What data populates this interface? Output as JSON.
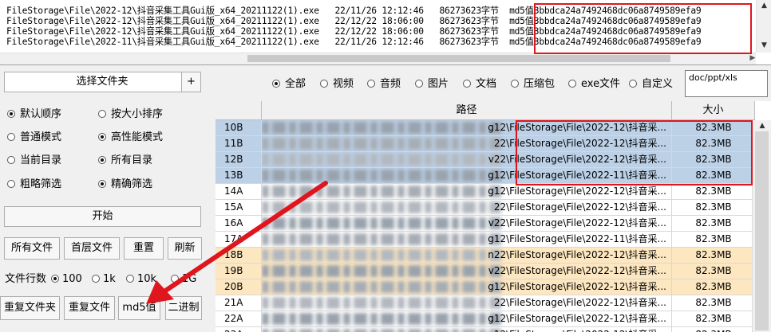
{
  "log": {
    "lines": [
      "FileStorage\\File\\2022-12\\抖音采集工具Gui版_x64_20211122(1).exe   22/11/26 12:12:46   86273623字节  md5值3bbdca24a7492468dc06a8749589efa9",
      "FileStorage\\File\\2022-12\\抖音采集工具Gui版_x64_20211122(1).exe   22/12/22 18:06:00   86273623字节  md5值3bbdca24a7492468dc06a8749589efa9",
      "FileStorage\\File\\2022-12\\抖音采集工具Gui版_x64_20211122(1).exe   22/12/22 18:06:00   86273623字节  md5值3bbdca24a7492468dc06a8749589efa9",
      "FileStorage\\File\\2022-11\\抖音采集工具Gui版_x64_20211122(1).exe   22/11/26 12:12:46   86273623字节  md5值3bbdca24a7492468dc06a8749589efa9"
    ]
  },
  "left": {
    "choose_folder": "选择文件夹",
    "plus": "+",
    "radios": [
      {
        "label": "默认顺序",
        "checked": true
      },
      {
        "label": "按大小排序",
        "checked": false
      },
      {
        "label": "普通模式",
        "checked": false
      },
      {
        "label": "高性能模式",
        "checked": true
      },
      {
        "label": "当前目录",
        "checked": false
      },
      {
        "label": "所有目录",
        "checked": true
      },
      {
        "label": "粗略筛选",
        "checked": false
      },
      {
        "label": "精确筛选",
        "checked": true
      }
    ],
    "start": "开始",
    "btns1": [
      "所有文件",
      "首层文件",
      "重置",
      "刷新"
    ],
    "rows_label": "文件行数",
    "rows_opts": [
      {
        "label": "100",
        "checked": true
      },
      {
        "label": "1k",
        "checked": false
      },
      {
        "label": "10k",
        "checked": false
      },
      {
        "label": "1G",
        "checked": false
      }
    ],
    "btns2": [
      "重复文件夹",
      "重复文件",
      "md5值",
      "二进制"
    ]
  },
  "filters": {
    "options": [
      {
        "label": "全部",
        "checked": true
      },
      {
        "label": "视频",
        "checked": false
      },
      {
        "label": "音频",
        "checked": false
      },
      {
        "label": "图片",
        "checked": false
      },
      {
        "label": "文档",
        "checked": false
      },
      {
        "label": "压缩包",
        "checked": false
      },
      {
        "label": "exe文件",
        "checked": false
      },
      {
        "label": "自定义",
        "checked": false
      }
    ],
    "custom_value": "doc/ppt/xls"
  },
  "table": {
    "headers": {
      "path": "路径",
      "size": "大小"
    },
    "rows": [
      {
        "id": "10B",
        "path_tail": "g12\\FileStorage\\File\\2022-12\\抖音采...",
        "size": "82.3MB",
        "bg": "#bcd0e6"
      },
      {
        "id": "11B",
        "path_tail": "22\\FileStorage\\File\\2022-12\\抖音采...",
        "size": "82.3MB",
        "bg": "#bcd0e6"
      },
      {
        "id": "12B",
        "path_tail": "v22\\FileStorage\\File\\2022-12\\抖音采...",
        "size": "82.3MB",
        "bg": "#bcd0e6"
      },
      {
        "id": "13B",
        "path_tail": "g12\\FileStorage\\File\\2022-11\\抖音采...",
        "size": "82.3MB",
        "bg": "#bcd0e6"
      },
      {
        "id": "14A",
        "path_tail": "g12\\FileStorage\\File\\2022-12\\抖音采...",
        "size": "82.3MB",
        "bg": "#ffffff"
      },
      {
        "id": "15A",
        "path_tail": "22\\FileStorage\\File\\2022-12\\抖音采...",
        "size": "82.3MB",
        "bg": "#ffffff"
      },
      {
        "id": "16A",
        "path_tail": "v22\\FileStorage\\File\\2022-12\\抖音采...",
        "size": "82.3MB",
        "bg": "#ffffff"
      },
      {
        "id": "17A",
        "path_tail": "g12\\FileStorage\\File\\2022-11\\抖音采...",
        "size": "82.3MB",
        "bg": "#ffffff"
      },
      {
        "id": "18B",
        "path_tail": "n22\\FileStorage\\File\\2022-12\\抖音采...",
        "size": "82.3MB",
        "bg": "#fde7c0"
      },
      {
        "id": "19B",
        "path_tail": "v22\\FileStorage\\File\\2022-12\\抖音采...",
        "size": "82.3MB",
        "bg": "#fde7c0"
      },
      {
        "id": "20B",
        "path_tail": "g12\\FileStorage\\File\\2022-12\\抖音采...",
        "size": "82.3MB",
        "bg": "#fde7c0"
      },
      {
        "id": "21A",
        "path_tail": "22\\FileStorage\\File\\2022-12\\抖音采...",
        "size": "82.3MB",
        "bg": "#ffffff"
      },
      {
        "id": "22A",
        "path_tail": "g12\\FileStorage\\File\\2022-12\\抖音采...",
        "size": "82.3MB",
        "bg": "#ffffff"
      },
      {
        "id": "23A",
        "path_tail": "g12\\FileStorage\\File\\2022-12\\抖音采...",
        "size": "82.3MB",
        "bg": "#ffffff"
      }
    ]
  },
  "colors": {
    "highlight_red": "#e0161e"
  }
}
